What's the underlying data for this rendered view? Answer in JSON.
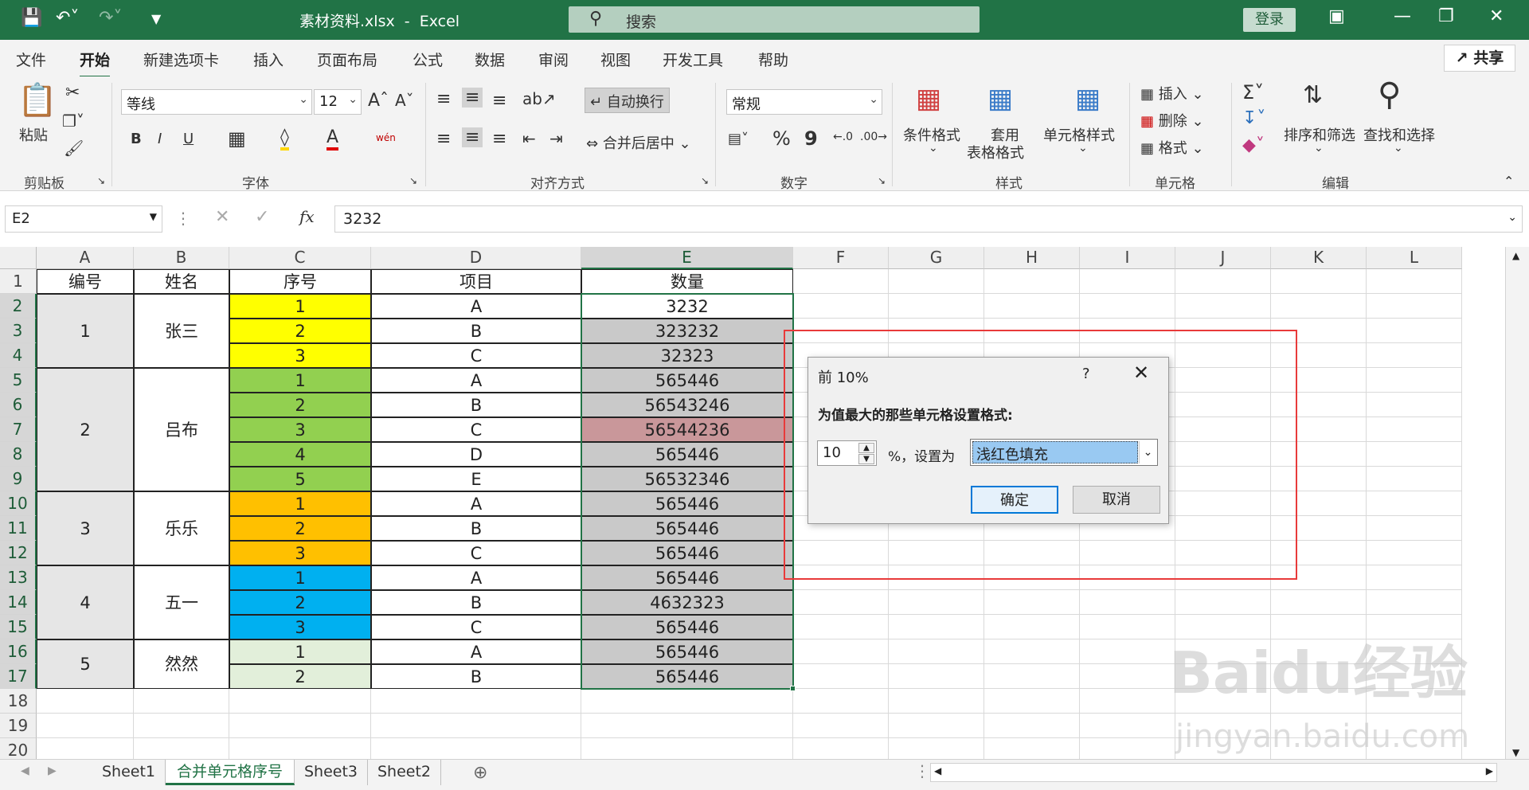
{
  "titlebar": {
    "doc_name": "素材资料.xlsx",
    "app_name": "Excel",
    "search_placeholder": "搜索",
    "login_label": "登录"
  },
  "menu": {
    "tabs": [
      "文件",
      "开始",
      "新建选项卡",
      "插入",
      "页面布局",
      "公式",
      "数据",
      "审阅",
      "视图",
      "开发工具",
      "帮助"
    ],
    "active_tab": "开始",
    "share_label": "共享"
  },
  "ribbon": {
    "clipboard": {
      "paste": "粘贴",
      "label": "剪贴板"
    },
    "font": {
      "name": "等线",
      "size": "12",
      "label": "字体",
      "bold": "B",
      "italic": "I",
      "underline": "U",
      "wen": "wén"
    },
    "align": {
      "wrap": "自动换行",
      "merge": "合并后居中",
      "label": "对齐方式"
    },
    "number": {
      "format": "常规",
      "label": "数字",
      "pct": "%",
      "comma": "9"
    },
    "styles": {
      "cond": "条件格式",
      "table": "套用",
      "table2": "表格格式",
      "cell": "单元格样式",
      "label": "样式"
    },
    "cells": {
      "insert": "插入",
      "delete": "删除",
      "format": "格式",
      "label": "单元格"
    },
    "edit": {
      "sort": "排序和筛选",
      "find": "查找和选择",
      "label": "编辑"
    }
  },
  "formula_bar": {
    "name_box": "E2",
    "fx": "fx",
    "value": "3232"
  },
  "columns": [
    "A",
    "B",
    "C",
    "D",
    "E",
    "F",
    "G",
    "H",
    "I",
    "J",
    "K",
    "L"
  ],
  "rows": [
    "1",
    "2",
    "3",
    "4",
    "5",
    "6",
    "7",
    "8",
    "9",
    "10",
    "11",
    "12",
    "13",
    "14",
    "15",
    "16",
    "17",
    "18",
    "19",
    "20"
  ],
  "headers": {
    "a": "编号",
    "b": "姓名",
    "c": "序号",
    "d": "项目",
    "e": "数量"
  },
  "groups": [
    {
      "id": "1",
      "name": "张三",
      "color": "#ffff00"
    },
    {
      "id": "2",
      "name": "吕布",
      "color": "#92d050"
    },
    {
      "id": "3",
      "name": "乐乐",
      "color": "#ffc000"
    },
    {
      "id": "4",
      "name": "五一",
      "color": "#00b0f0"
    },
    {
      "id": "5",
      "name": "然然",
      "color": "#e2efda"
    }
  ],
  "data_rows": [
    {
      "seq": "1",
      "item": "A",
      "qty": "3232"
    },
    {
      "seq": "2",
      "item": "B",
      "qty": "323232"
    },
    {
      "seq": "3",
      "item": "C",
      "qty": "32323"
    },
    {
      "seq": "1",
      "item": "A",
      "qty": "565446"
    },
    {
      "seq": "2",
      "item": "B",
      "qty": "56543246"
    },
    {
      "seq": "3",
      "item": "C",
      "qty": "56544236"
    },
    {
      "seq": "4",
      "item": "D",
      "qty": "565446"
    },
    {
      "seq": "5",
      "item": "E",
      "qty": "56532346"
    },
    {
      "seq": "1",
      "item": "A",
      "qty": "565446"
    },
    {
      "seq": "2",
      "item": "B",
      "qty": "565446"
    },
    {
      "seq": "3",
      "item": "C",
      "qty": "565446"
    },
    {
      "seq": "1",
      "item": "A",
      "qty": "565446"
    },
    {
      "seq": "2",
      "item": "B",
      "qty": "4632323"
    },
    {
      "seq": "3",
      "item": "C",
      "qty": "565446"
    },
    {
      "seq": "1",
      "item": "A",
      "qty": "565446"
    },
    {
      "seq": "2",
      "item": "B",
      "qty": "565446"
    }
  ],
  "colors": {
    "accent": "#217346",
    "qty_fill": "#c9c9c9",
    "qty_highlight": "#c9979a",
    "merged_fill": "#e6e6e6"
  },
  "dialog": {
    "title": "前 10%",
    "help": "?",
    "message": "为值最大的那些单元格设置格式:",
    "value": "10",
    "pct_label": "%，设置为",
    "format": "浅红色填充",
    "ok": "确定",
    "cancel": "取消"
  },
  "sheets": [
    "Sheet1",
    "合并单元格序号",
    "Sheet3",
    "Sheet2"
  ],
  "active_sheet": "合并单元格序号",
  "watermark": {
    "brand": "Baidu经验",
    "url": "jingyan.baidu.com"
  }
}
